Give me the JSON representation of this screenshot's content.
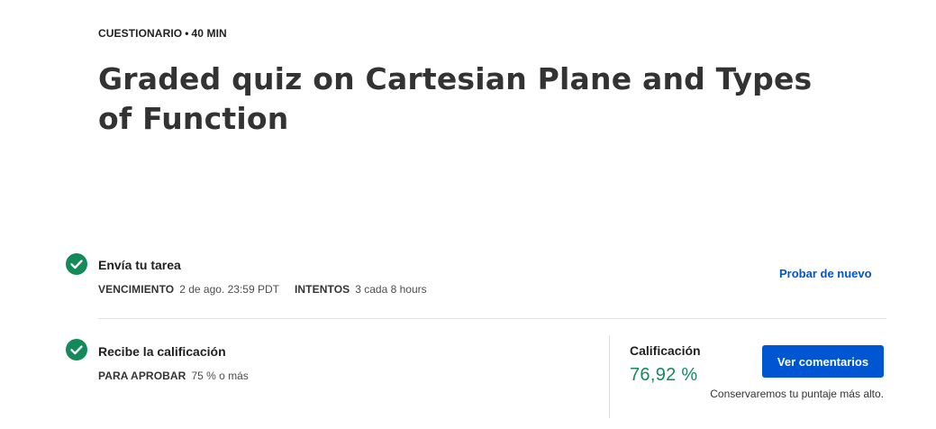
{
  "header": {
    "type_label": "CUESTIONARIO",
    "separator": "•",
    "duration": "40 MIN",
    "title": "Graded quiz on Cartesian Plane and Types of Function"
  },
  "submit_step": {
    "title": "Envía tu tarea",
    "due_label": "VENCIMIENTO",
    "due_value": "2 de ago. 23:59 PDT",
    "attempts_label": "INTENTOS",
    "attempts_value": "3 cada 8 hours",
    "retry_link": "Probar de nuevo"
  },
  "grade_step": {
    "title": "Recibe la calificación",
    "pass_label": "PARA APROBAR",
    "pass_value": "75 % o más",
    "grade_label": "Calificación",
    "grade_value": "76,92 %",
    "feedback_button": "Ver comentarios",
    "keep_note": "Conservaremos tu puntaje más alto."
  },
  "colors": {
    "success": "#148a5b",
    "primary": "#0056d2"
  },
  "icons": {
    "submit_step": "check-circle-icon",
    "grade_step": "check-circle-icon"
  }
}
